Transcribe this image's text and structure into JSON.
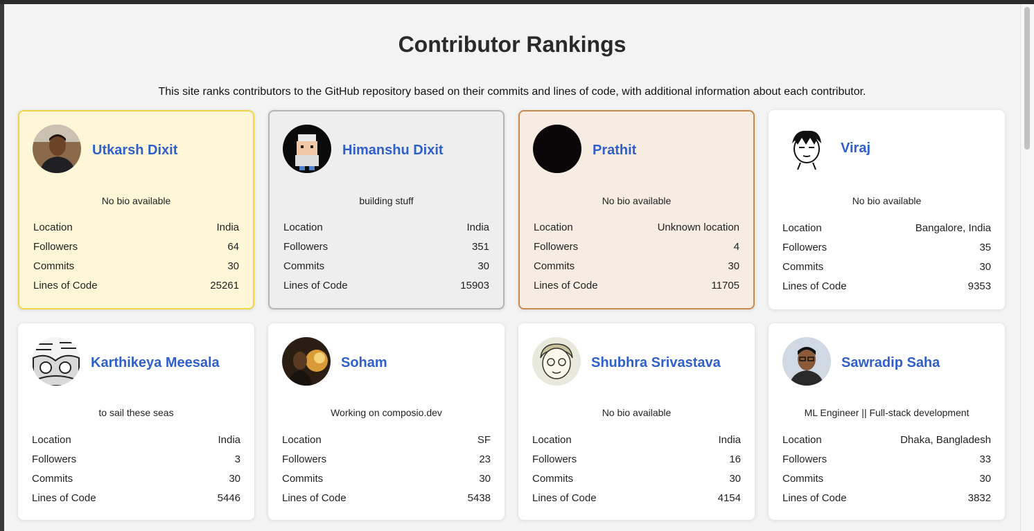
{
  "page": {
    "title": "Contributor Rankings",
    "description": "This site ranks contributors to the GitHub repository based on their commits and lines of code, with additional information about each contributor."
  },
  "labels": {
    "location": "Location",
    "followers": "Followers",
    "commits": "Commits",
    "loc": "Lines of Code"
  },
  "contributors": [
    {
      "name": "Utkarsh Dixit",
      "bio": "No bio available",
      "location": "India",
      "followers": "64",
      "commits": "30",
      "loc": "25261",
      "rank_style": "gold"
    },
    {
      "name": "Himanshu Dixit",
      "bio": "building stuff",
      "location": "India",
      "followers": "351",
      "commits": "30",
      "loc": "15903",
      "rank_style": "silver"
    },
    {
      "name": "Prathit",
      "bio": "No bio available",
      "location": "Unknown location",
      "followers": "4",
      "commits": "30",
      "loc": "11705",
      "rank_style": "bronze"
    },
    {
      "name": "Viraj",
      "bio": "No bio available",
      "location": "Bangalore, India",
      "followers": "35",
      "commits": "30",
      "loc": "9353",
      "rank_style": "default"
    },
    {
      "name": "Karthikeya Meesala",
      "bio": "to sail these seas",
      "location": "India",
      "followers": "3",
      "commits": "30",
      "loc": "5446",
      "rank_style": "default"
    },
    {
      "name": "Soham",
      "bio": "Working on composio.dev",
      "location": "SF",
      "followers": "23",
      "commits": "30",
      "loc": "5438",
      "rank_style": "default"
    },
    {
      "name": "Shubhra Srivastava",
      "bio": "No bio available",
      "location": "India",
      "followers": "16",
      "commits": "30",
      "loc": "4154",
      "rank_style": "default"
    },
    {
      "name": "Sawradip Saha",
      "bio": "ML Engineer || Full-stack development",
      "location": "Dhaka, Bangladesh",
      "followers": "33",
      "commits": "30",
      "loc": "3832",
      "rank_style": "default"
    }
  ],
  "colors": {
    "name_link": "#2f5fca",
    "gold_bg": "#fdf7d8",
    "gold_border": "#f2d44b",
    "silver_bg": "#eeeeee",
    "silver_border": "#b4b4b4",
    "bronze_bg": "#f6ece2",
    "bronze_border": "#c98a4e"
  }
}
